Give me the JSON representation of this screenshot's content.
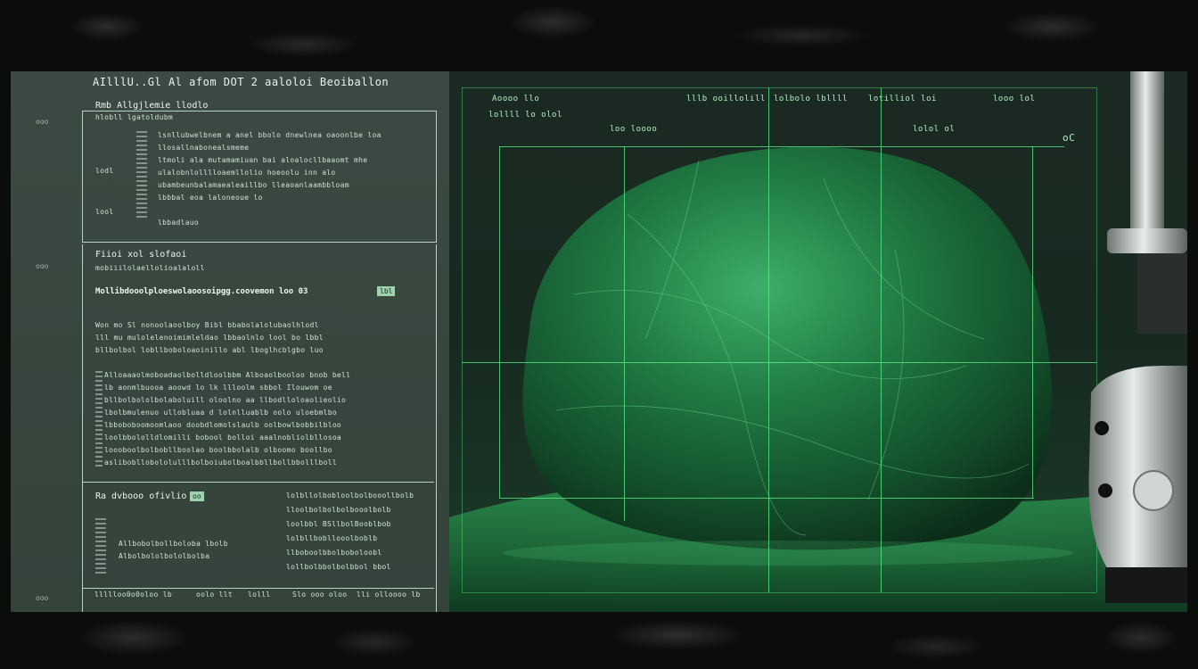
{
  "panel": {
    "top_title": "AIlllU..Gl Al afom DOT 2 aaloloi Beoiballon",
    "side_labels": [
      "ooo",
      "ooo",
      "ooo"
    ],
    "doc1": {
      "title": "Rmb Allgjlemie llodlo",
      "subtitle": "hlobll lgatoldubm",
      "left_labels": [
        "lodl",
        "lool"
      ],
      "rows": [
        "lsnllubwelbnem a anel bbolo dnewlnea oaoonlbe loa",
        "llosallnabonealsmeme",
        "ltmoli ala mutamamiuan bai aloalocllbaaomt mhe",
        "ulalobnlolllloaemllolio hoeoolu inn alo",
        "ubambeunbalamaealeaillbo lleaoanlaambbloam",
        "lbbbal eoa laloneoue lo",
        "lbbadlauo"
      ]
    },
    "doc2": {
      "title": "Fiioi xol slofaoi",
      "subtitle": "mobiiilolaellolioalaloll",
      "bold_line": "Mollibdooolploeswolaoosoipgg.coovemon loo 03",
      "tag": "lbl",
      "para1": [
        "Won mo Sl nonoolaoolboy Bibl bbabolalolubaolhlodl",
        "lll mu mulolelenoimimleldao lbbaolnlo lool bo lbbl",
        "bllbolbol lobllboboloaoinillo abl lboglhcblgbo luo"
      ],
      "para2": [
        "Alloaaaolmoboadaolbolldloolbbm Alboaolbooloo bnob bell",
        "lb aonmlbuooa aoowd lo lk llloolm sbbol Ilouwom oe",
        "bllbolbololbolaboluill oloolno aa llbodlloloaolieolio",
        "lbolbmulenuo ullobluaa d lolnlluablb oolo uloebmlbo",
        "lbboboboomoomlaoo doobdlomolslaulb oolbowlbobbilbloo",
        "loolbbololldlomilli bobool bolloi aaalnobliolbllosoa",
        "loooboolbolbobllboolao boolbbolalb olboomo boollbo",
        "aslibobllobololulllbolboiubolboalbbllbollbbolllboll"
      ]
    },
    "doc3": {
      "title": "Ra dvbooo ofivlio",
      "tag": "oo",
      "rows_left": [
        "Allbobolbollboloba lbolb",
        "Albolbololbololbolba"
      ],
      "rows_right": [
        "lolbllolbobloolbolbooollbolb",
        "lloolbolbolbolbooolbolb",
        "loolbbl BSllbolBooblbob",
        "lolbllbobllooolboblb",
        "llboboolbbolboboloobl",
        "lollbolbbolbolbbol bbol"
      ]
    },
    "footer": [
      "llllloo0o0oloo lb",
      "oolo llt",
      "lolll",
      "Slo ooo oloo",
      "lli olloooo lb"
    ]
  },
  "viewport": {
    "header_labels": [
      "Aoooo llo",
      "lllb ooillolill",
      "lolbolo lbllll",
      "lotilliol loi",
      "looo lol"
    ],
    "sub_labels": [
      "lollll lo olol",
      "loo loooo",
      "lolol ol"
    ],
    "corner_label": "oC"
  },
  "colors": {
    "grid": "#5cf08a",
    "panel_bg": "#3b4a42",
    "stone": "#1f7a43"
  }
}
